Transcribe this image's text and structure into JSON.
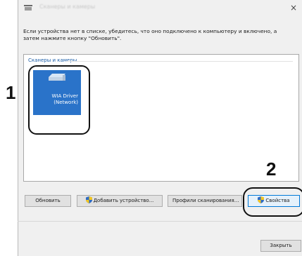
{
  "window": {
    "title": "Сканеры и камеры",
    "close_glyph": "×",
    "app_icon": "scanner-icon"
  },
  "instruction": "Если устройства нет в списке, убедитесь, что оно подключено к компьютеру и включено, а\nзатем нажмите кнопку \"Обновить\".",
  "device_panel": {
    "group_header": "Сканеры и камеры",
    "devices": [
      {
        "name": "WIA Driver\n(Network)",
        "icon": "scanner-icon",
        "selected": true
      }
    ]
  },
  "buttons": {
    "refresh": "Обновить",
    "add_device": "Добавить устройство...",
    "scan_profiles": "Профили сканирования...",
    "properties": "Свойства",
    "close": "Закрыть"
  },
  "callouts": {
    "step1": "1",
    "step2": "2"
  },
  "colors": {
    "selection": "#2a73c9",
    "shield_blue": "#2f6cc5",
    "shield_yellow": "#f3c623",
    "callout": "#111111"
  }
}
